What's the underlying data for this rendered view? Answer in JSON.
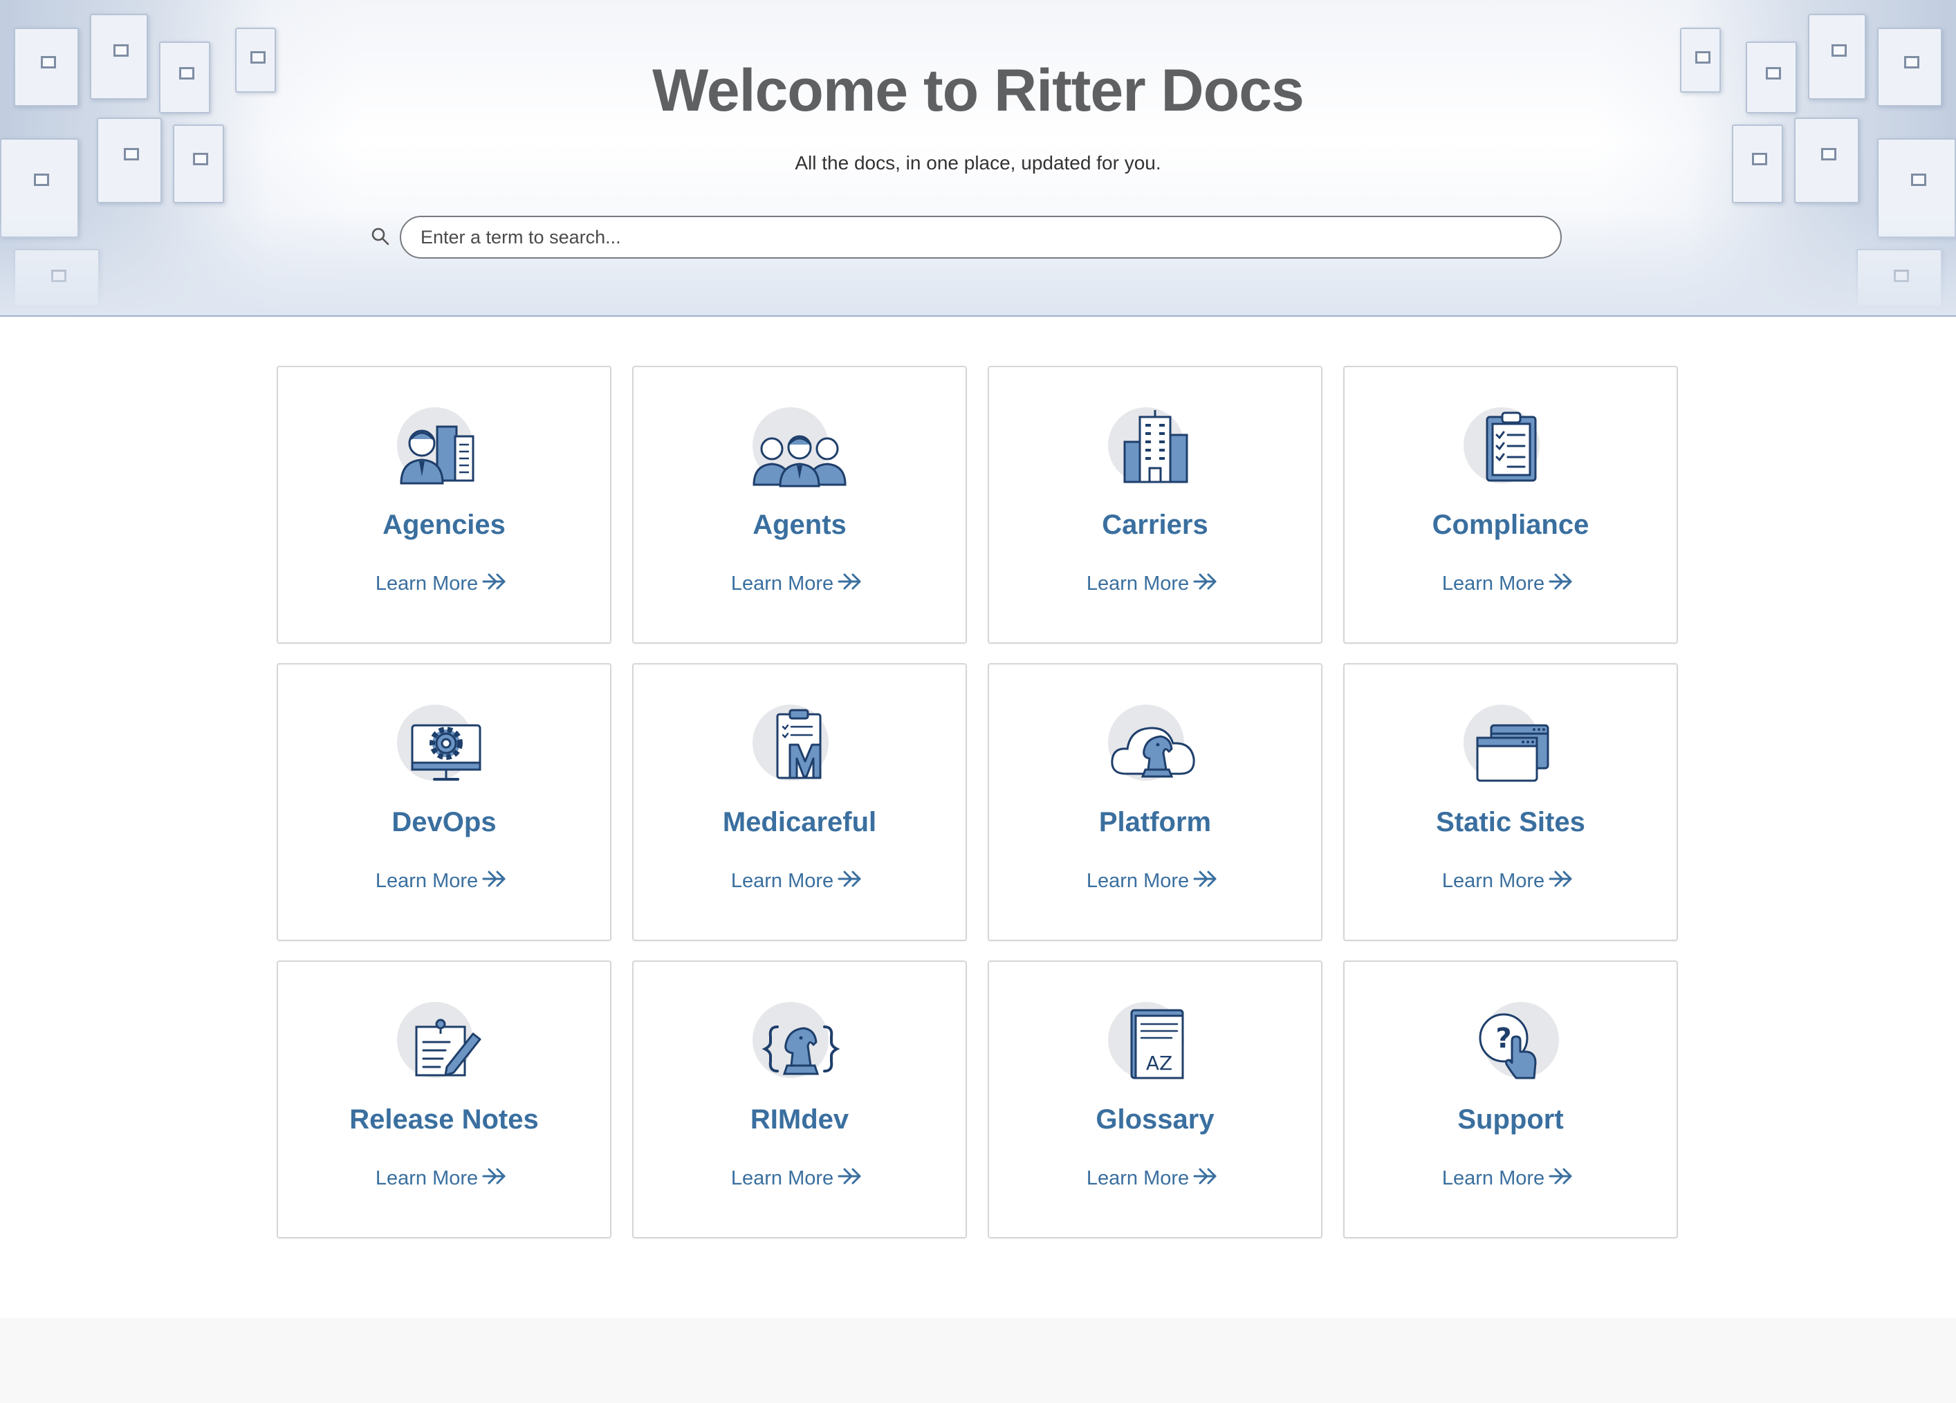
{
  "hero": {
    "title": "Welcome to Ritter Docs",
    "subtitle": "All the docs, in one place, updated for you.",
    "search_placeholder": "Enter a term to search...",
    "search_icon": "search-icon"
  },
  "colors": {
    "accent": "#3a6f9f",
    "icon_fill": "#6c95c4",
    "icon_stroke": "#1f3f6b",
    "icon_bg": "#e6e7ea",
    "title": "#5f6062"
  },
  "cards": [
    {
      "title": "Agencies",
      "link": "Learn More",
      "icon": "agencies-icon"
    },
    {
      "title": "Agents",
      "link": "Learn More",
      "icon": "agents-icon"
    },
    {
      "title": "Carriers",
      "link": "Learn More",
      "icon": "carriers-icon"
    },
    {
      "title": "Compliance",
      "link": "Learn More",
      "icon": "compliance-icon"
    },
    {
      "title": "DevOps",
      "link": "Learn More",
      "icon": "devops-icon"
    },
    {
      "title": "Medicareful",
      "link": "Learn More",
      "icon": "medicareful-icon"
    },
    {
      "title": "Platform",
      "link": "Learn More",
      "icon": "platform-icon"
    },
    {
      "title": "Static Sites",
      "link": "Learn More",
      "icon": "static-sites-icon"
    },
    {
      "title": "Release Notes",
      "link": "Learn More",
      "icon": "release-notes-icon"
    },
    {
      "title": "RIMdev",
      "link": "Learn More",
      "icon": "rimdev-icon"
    },
    {
      "title": "Glossary",
      "link": "Learn More",
      "icon": "glossary-icon",
      "icon_text": "AZ"
    },
    {
      "title": "Support",
      "link": "Learn More",
      "icon": "support-icon",
      "icon_text": "?"
    }
  ]
}
